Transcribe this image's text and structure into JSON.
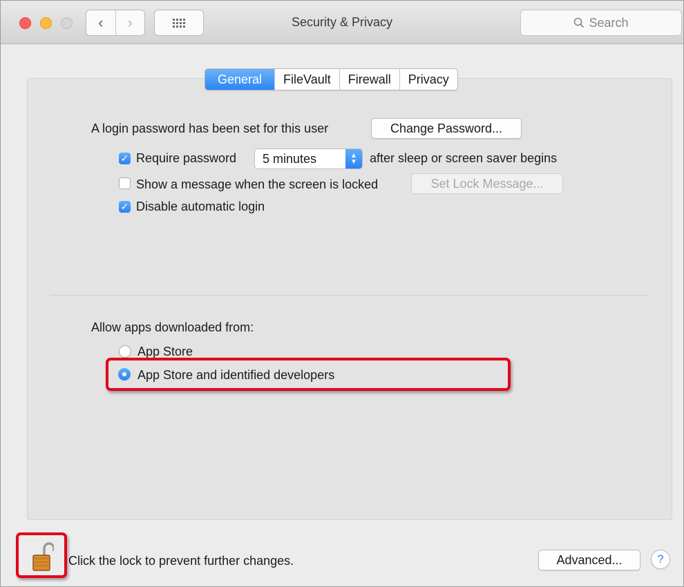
{
  "window": {
    "title": "Security & Privacy",
    "search_placeholder": "Search",
    "traffic_lights": [
      "#fc605c",
      "#fdbc40",
      "#d0d0d0"
    ]
  },
  "toolbar": {
    "back_glyph": "‹",
    "forward_glyph": "›"
  },
  "tabs": [
    {
      "label": "General",
      "selected": true
    },
    {
      "label": "FileVault",
      "selected": false
    },
    {
      "label": "Firewall",
      "selected": false
    },
    {
      "label": "Privacy",
      "selected": false
    }
  ],
  "general": {
    "login_text": "A login password has been set for this user",
    "change_password_label": "Change Password...",
    "require_password": {
      "label": "Require password",
      "checked": true
    },
    "require_password_delay": "5 minutes",
    "after_sleep_text": "after sleep or screen saver begins",
    "show_message": {
      "label": "Show a message when the screen is locked",
      "checked": false
    },
    "set_lock_message_label": "Set Lock Message...",
    "disable_auto_login": {
      "label": "Disable automatic login",
      "checked": true
    },
    "allow_apps_label": "Allow apps downloaded from:",
    "app_sources": [
      {
        "label": "App Store",
        "selected": false
      },
      {
        "label": "App Store and identified developers",
        "selected": true
      }
    ]
  },
  "footer": {
    "lock_text": "Click the lock to prevent further changes.",
    "advanced_label": "Advanced...",
    "help_glyph": "?"
  },
  "colors": {
    "accent": "#2a86f3",
    "highlight": "#e3001b"
  }
}
